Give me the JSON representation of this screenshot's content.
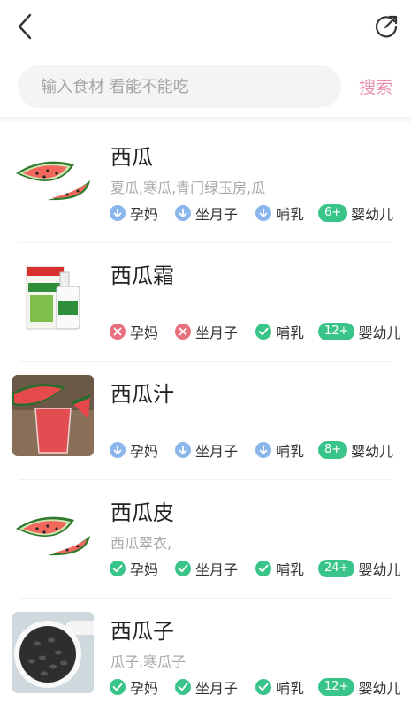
{
  "search": {
    "placeholder": "输入食材 看能不能吃",
    "button_label": "搜索"
  },
  "colors": {
    "accent": "#ea8fb3",
    "ok": "#39c48a",
    "no": "#e8707d",
    "caution": "#8ab6ec"
  },
  "items": [
    {
      "name": "西瓜",
      "alias": "夏瓜,寒瓜,青门绿玉房,瓜",
      "image": "watermelon-slice",
      "tags": [
        {
          "label": "孕妈",
          "status": "caution"
        },
        {
          "label": "坐月子",
          "status": "caution"
        },
        {
          "label": "哺乳",
          "status": "caution"
        },
        {
          "label": "婴幼儿",
          "age": "6+"
        }
      ]
    },
    {
      "name": "西瓜霜",
      "alias": "",
      "image": "medicine-spray",
      "tags": [
        {
          "label": "孕妈",
          "status": "no"
        },
        {
          "label": "坐月子",
          "status": "no"
        },
        {
          "label": "哺乳",
          "status": "ok"
        },
        {
          "label": "婴幼儿",
          "age": "12+"
        }
      ]
    },
    {
      "name": "西瓜汁",
      "alias": "",
      "image": "watermelon-juice",
      "tags": [
        {
          "label": "孕妈",
          "status": "caution"
        },
        {
          "label": "坐月子",
          "status": "caution"
        },
        {
          "label": "哺乳",
          "status": "caution"
        },
        {
          "label": "婴幼儿",
          "age": "8+"
        }
      ]
    },
    {
      "name": "西瓜皮",
      "alias": "西瓜翠衣,",
      "image": "watermelon-slice",
      "tags": [
        {
          "label": "孕妈",
          "status": "ok"
        },
        {
          "label": "坐月子",
          "status": "ok"
        },
        {
          "label": "哺乳",
          "status": "ok"
        },
        {
          "label": "婴幼儿",
          "age": "24+"
        }
      ]
    },
    {
      "name": "西瓜子",
      "alias": "瓜子,寒瓜子",
      "image": "watermelon-seeds",
      "tags": [
        {
          "label": "孕妈",
          "status": "ok"
        },
        {
          "label": "坐月子",
          "status": "ok"
        },
        {
          "label": "哺乳",
          "status": "ok"
        },
        {
          "label": "婴幼儿",
          "age": "12+"
        }
      ]
    }
  ]
}
